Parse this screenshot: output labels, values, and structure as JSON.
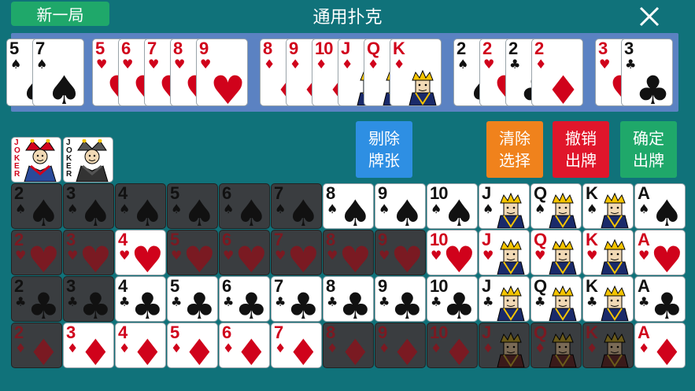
{
  "header": {
    "new_game_label": "新一局",
    "title": "通用扑克"
  },
  "icons": {
    "close": "close-icon"
  },
  "colors": {
    "table": "#10727a",
    "tray": "#5b82c2",
    "new_game_button": "#1fa86a",
    "remove_button": "#2e8fe3",
    "clear_button": "#f0821c",
    "undo_button": "#e0162b",
    "confirm_button": "#1fa86a",
    "red_suit": "#d0021b"
  },
  "tray_groups": [
    {
      "cards": [
        {
          "rank": "5",
          "suit": "♠"
        },
        {
          "rank": "7",
          "suit": "♠"
        }
      ]
    },
    {
      "cards": [
        {
          "rank": "5",
          "suit": "♥"
        },
        {
          "rank": "6",
          "suit": "♥"
        },
        {
          "rank": "7",
          "suit": "♥"
        },
        {
          "rank": "8",
          "suit": "♥"
        },
        {
          "rank": "9",
          "suit": "♥"
        }
      ]
    },
    {
      "cards": [
        {
          "rank": "8",
          "suit": "♦"
        },
        {
          "rank": "9",
          "suit": "♦"
        },
        {
          "rank": "10",
          "suit": "♦"
        },
        {
          "rank": "J",
          "suit": "♦"
        },
        {
          "rank": "Q",
          "suit": "♦"
        },
        {
          "rank": "K",
          "suit": "♦"
        }
      ]
    },
    {
      "cards": [
        {
          "rank": "2",
          "suit": "♠"
        },
        {
          "rank": "2",
          "suit": "♥"
        },
        {
          "rank": "2",
          "suit": "♣"
        },
        {
          "rank": "2",
          "suit": "♦"
        }
      ]
    },
    {
      "cards": [
        {
          "rank": "3",
          "suit": "♥"
        },
        {
          "rank": "3",
          "suit": "♣"
        }
      ]
    }
  ],
  "jokers": [
    {
      "label": "JOKER",
      "color": "red"
    },
    {
      "label": "JOKER",
      "color": "black"
    }
  ],
  "buttons": {
    "remove": [
      "剔除",
      "牌张"
    ],
    "clear": [
      "清除",
      "选择"
    ],
    "undo": [
      "撤销",
      "出牌"
    ],
    "confirm": [
      "确定",
      "出牌"
    ]
  },
  "grid": {
    "rows": [
      {
        "suit": "♠",
        "cards": [
          {
            "rank": "2",
            "used": true
          },
          {
            "rank": "3",
            "used": true
          },
          {
            "rank": "4",
            "used": true
          },
          {
            "rank": "5",
            "used": true
          },
          {
            "rank": "6",
            "used": true
          },
          {
            "rank": "7",
            "used": true
          },
          {
            "rank": "8",
            "used": false
          },
          {
            "rank": "9",
            "used": false
          },
          {
            "rank": "10",
            "used": false
          },
          {
            "rank": "J",
            "used": false
          },
          {
            "rank": "Q",
            "used": false
          },
          {
            "rank": "K",
            "used": false
          },
          {
            "rank": "A",
            "used": false
          }
        ]
      },
      {
        "suit": "♥",
        "cards": [
          {
            "rank": "2",
            "used": true
          },
          {
            "rank": "3",
            "used": true
          },
          {
            "rank": "4",
            "used": false
          },
          {
            "rank": "5",
            "used": true
          },
          {
            "rank": "6",
            "used": true
          },
          {
            "rank": "7",
            "used": true
          },
          {
            "rank": "8",
            "used": true
          },
          {
            "rank": "9",
            "used": true
          },
          {
            "rank": "10",
            "used": false
          },
          {
            "rank": "J",
            "used": false
          },
          {
            "rank": "Q",
            "used": false
          },
          {
            "rank": "K",
            "used": false
          },
          {
            "rank": "A",
            "used": false
          }
        ]
      },
      {
        "suit": "♣",
        "cards": [
          {
            "rank": "2",
            "used": true
          },
          {
            "rank": "3",
            "used": true
          },
          {
            "rank": "4",
            "used": false
          },
          {
            "rank": "5",
            "used": false
          },
          {
            "rank": "6",
            "used": false
          },
          {
            "rank": "7",
            "used": false
          },
          {
            "rank": "8",
            "used": false
          },
          {
            "rank": "9",
            "used": false
          },
          {
            "rank": "10",
            "used": false
          },
          {
            "rank": "J",
            "used": false
          },
          {
            "rank": "Q",
            "used": false
          },
          {
            "rank": "K",
            "used": false
          },
          {
            "rank": "A",
            "used": false
          }
        ]
      },
      {
        "suit": "♦",
        "cards": [
          {
            "rank": "2",
            "used": true
          },
          {
            "rank": "3",
            "used": false
          },
          {
            "rank": "4",
            "used": false
          },
          {
            "rank": "5",
            "used": false
          },
          {
            "rank": "6",
            "used": false
          },
          {
            "rank": "7",
            "used": false
          },
          {
            "rank": "8",
            "used": true
          },
          {
            "rank": "9",
            "used": true
          },
          {
            "rank": "10",
            "used": true
          },
          {
            "rank": "J",
            "used": true
          },
          {
            "rank": "Q",
            "used": true
          },
          {
            "rank": "K",
            "used": true
          },
          {
            "rank": "A",
            "used": false
          }
        ]
      }
    ]
  }
}
